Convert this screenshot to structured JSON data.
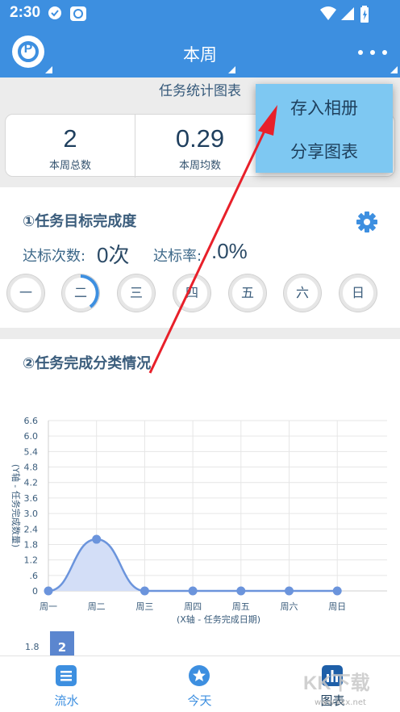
{
  "status_bar": {
    "time": "2:30"
  },
  "app_bar": {
    "title": "本周"
  },
  "section_title": "任务统计图表",
  "stats": [
    {
      "value": "2",
      "label": "本周总数"
    },
    {
      "value": "0.29",
      "label": "本周均数"
    }
  ],
  "goal_panel": {
    "title": "①任务目标完成度",
    "hits_label": "达标次数:",
    "hits_value": "0次",
    "rate_label": "达标率:",
    "rate_value": ".0%",
    "days": [
      "一",
      "二",
      "三",
      "四",
      "五",
      "六",
      "日"
    ]
  },
  "category_panel": {
    "title": "②任务完成分类情况"
  },
  "chart_data": {
    "type": "area",
    "categories": [
      "周一",
      "周二",
      "周三",
      "周四",
      "周五",
      "周六",
      "周日"
    ],
    "values": [
      0,
      2,
      0,
      0,
      0,
      0,
      0
    ],
    "ylabel": "(Y轴 - 任务完成数量)",
    "xlabel": "(X轴 - 任务完成日期)",
    "yticks": [
      "0",
      ".6",
      "1.2",
      "1.8",
      "2.4",
      "3.0",
      "3.6",
      "4.2",
      "4.8",
      "5.4",
      "6.0",
      "6.6"
    ],
    "ylim": [
      0,
      6.6
    ],
    "grid": true,
    "line_color": "#6b94dc",
    "fill_color": "#d3def7"
  },
  "second_chart": {
    "bar_label": "2",
    "ytick": "1.8"
  },
  "popup_menu": {
    "items": [
      "存入相册",
      "分享图表"
    ]
  },
  "bottom_nav": [
    {
      "label": "流水",
      "icon": "list-icon"
    },
    {
      "label": "今天",
      "icon": "star-icon"
    },
    {
      "label": "图表",
      "icon": "bar-chart-icon"
    }
  ],
  "watermark": {
    "text": "KK下载",
    "url": "www.kkx.net"
  },
  "colors": {
    "primary": "#3d8fe0",
    "popup": "#7ec8f2",
    "annotation_arrow": "#e8202a"
  }
}
